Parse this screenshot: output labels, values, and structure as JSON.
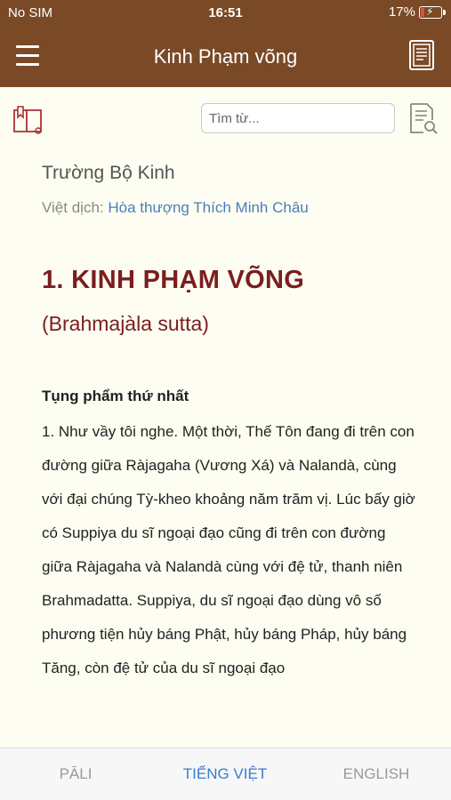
{
  "status": {
    "carrier": "No SIM",
    "time": "16:51",
    "battery": "17%",
    "battery_level": 0.17
  },
  "header": {
    "title": "Kinh Phạm võng"
  },
  "toolbar": {
    "search_placeholder": "Tìm từ..."
  },
  "content": {
    "collection": "Trường Bộ Kinh",
    "translator_label": "Việt dịch:",
    "translator_name": "Hòa thượng Thích Minh Châu",
    "title": "1. KINH PHẠM VÕNG",
    "subtitle": "(Brahmajàla sutta)",
    "section": "Tụng phẩm thứ nhất",
    "paragraph": "1. Như vầy tôi nghe. Một thời, Thế Tôn đang đi trên con đường giữa Ràjagaha (Vương Xá) và Nalandà, cùng với đại chúng Tỳ-kheo khoảng năm trăm vị. Lúc bấy giờ có Suppiya du sĩ ngoại đạo cũng đi trên con đường giữa Ràjagaha và Nalandà cùng với đệ tử, thanh niên Brahmadatta. Suppiya, du sĩ ngoại đạo dùng vô số phương tiện hủy báng Phật, hủy báng Pháp, hủy báng Tăng, còn đệ tử của du sĩ ngoại đạo"
  },
  "tabs": {
    "pali": "PĀLI",
    "vietnamese": "TIẾNG VIỆT",
    "english": "ENGLISH",
    "active": "vietnamese"
  },
  "colors": {
    "header_bg": "#7a4a26",
    "page_bg": "#fefdf1",
    "title": "#7a1e1e",
    "link": "#4a7dbd",
    "active_tab": "#3a7bd5"
  },
  "icons": {
    "menu": "hamburger-icon",
    "book": "book-icon",
    "bookmark": "bookmark-icon",
    "search_doc": "document-search-icon"
  }
}
